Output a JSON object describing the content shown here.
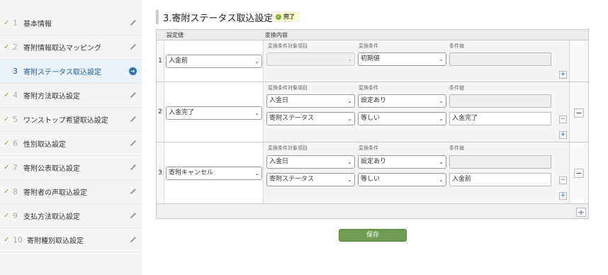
{
  "sidebar": {
    "items": [
      {
        "num": "1",
        "label": "基本情報",
        "check": "✓"
      },
      {
        "num": "2",
        "label": "寄附情報取込マッピング",
        "check": "✓"
      },
      {
        "num": "3",
        "label": "寄附ステータス取込設定",
        "check": ""
      },
      {
        "num": "4",
        "label": "寄附方法取込設定",
        "check": "✓"
      },
      {
        "num": "5",
        "label": "ワンストップ希望取込設定",
        "check": "✓"
      },
      {
        "num": "6",
        "label": "性別取込設定",
        "check": "✓"
      },
      {
        "num": "7",
        "label": "寄附公表取込設定",
        "check": "✓"
      },
      {
        "num": "8",
        "label": "寄附者の声取込設定",
        "check": "✓"
      },
      {
        "num": "9",
        "label": "支払方法取込設定",
        "check": "✓"
      },
      {
        "num": "10",
        "label": "寄附種別取込設定",
        "check": "✓"
      }
    ]
  },
  "page": {
    "title": "3.寄附ステータス取込設定",
    "badge": "完了",
    "save_label": "保存"
  },
  "table": {
    "headers": {
      "setting": "設定値",
      "conversion": "変換内容"
    },
    "sublabels": {
      "target": "変換条件対象項目",
      "condition": "変換条件",
      "value": "条件値"
    },
    "rows": [
      {
        "num": "1",
        "setting": "入金前",
        "conditions": [
          {
            "target": "",
            "condition": "初期値",
            "value": ""
          }
        ]
      },
      {
        "num": "2",
        "setting": "入金完了",
        "conditions": [
          {
            "target": "入金日",
            "condition": "設定あり",
            "value": ""
          },
          {
            "target": "寄附ステータス",
            "condition": "等しい",
            "value": "入金完了"
          }
        ]
      },
      {
        "num": "3",
        "setting": "寄附キャンセル",
        "conditions": [
          {
            "target": "入金日",
            "condition": "設定あり",
            "value": ""
          },
          {
            "target": "寄附ステータス",
            "condition": "等しい",
            "value": "入金前"
          }
        ]
      }
    ]
  },
  "colors": {
    "accent": "#2a6fb5",
    "save": "#6c9d52",
    "check": "#9aa83b",
    "badge_bg": "#fdfbd0"
  },
  "icons": {
    "edit": "pencil-icon",
    "current": "arrow-right-circle-icon",
    "done": "check-icon"
  }
}
